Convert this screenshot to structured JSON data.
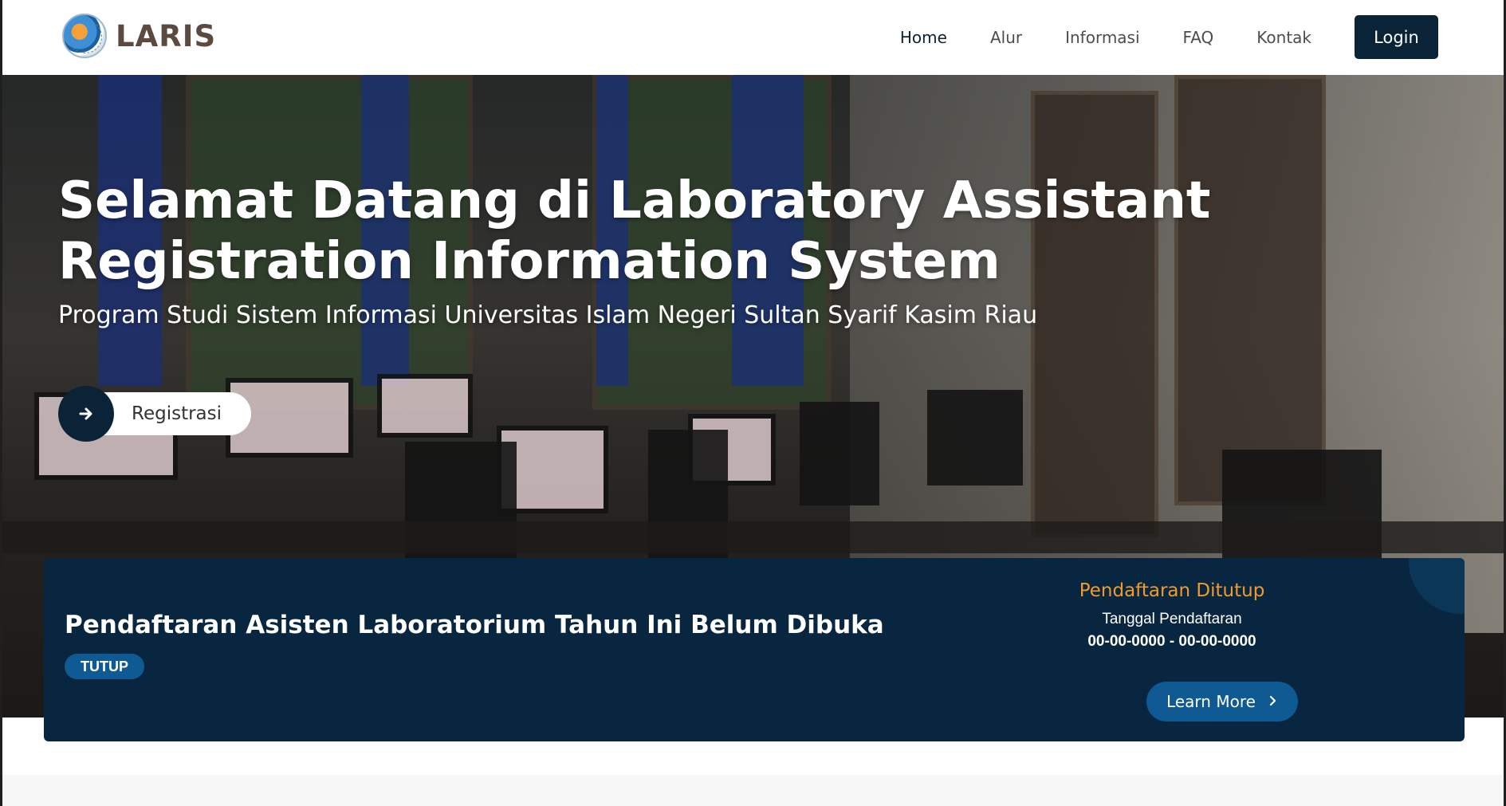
{
  "brand": {
    "name": "LARIS"
  },
  "nav": {
    "items": [
      {
        "label": "Home",
        "active": true
      },
      {
        "label": "Alur",
        "active": false
      },
      {
        "label": "Informasi",
        "active": false
      },
      {
        "label": "FAQ",
        "active": false
      },
      {
        "label": "Kontak",
        "active": false
      }
    ],
    "login_label": "Login"
  },
  "hero": {
    "title": "Selamat Datang di Laboratory Assistant Registration Information System",
    "subtitle": "Program Studi Sistem Informasi Universitas Islam Negeri Sultan Syarif Kasim Riau",
    "register_label": "Registrasi",
    "register_icon": "arrow-right-icon"
  },
  "status": {
    "title": "Pendaftaran Asisten Laboratorium Tahun Ini Belum Dibuka",
    "badge": "TUTUP",
    "closed_label": "Pendaftaran Ditutup",
    "date_label": "Tanggal Pendaftaran",
    "date_range": "00-00-0000 - 00-00-0000",
    "learn_more_label": "Learn More",
    "learn_more_icon": "chevron-right-icon"
  },
  "colors": {
    "primary_dark": "#0b2336",
    "accent_blue": "#0f5a93",
    "closed_orange": "#f29a2e"
  }
}
